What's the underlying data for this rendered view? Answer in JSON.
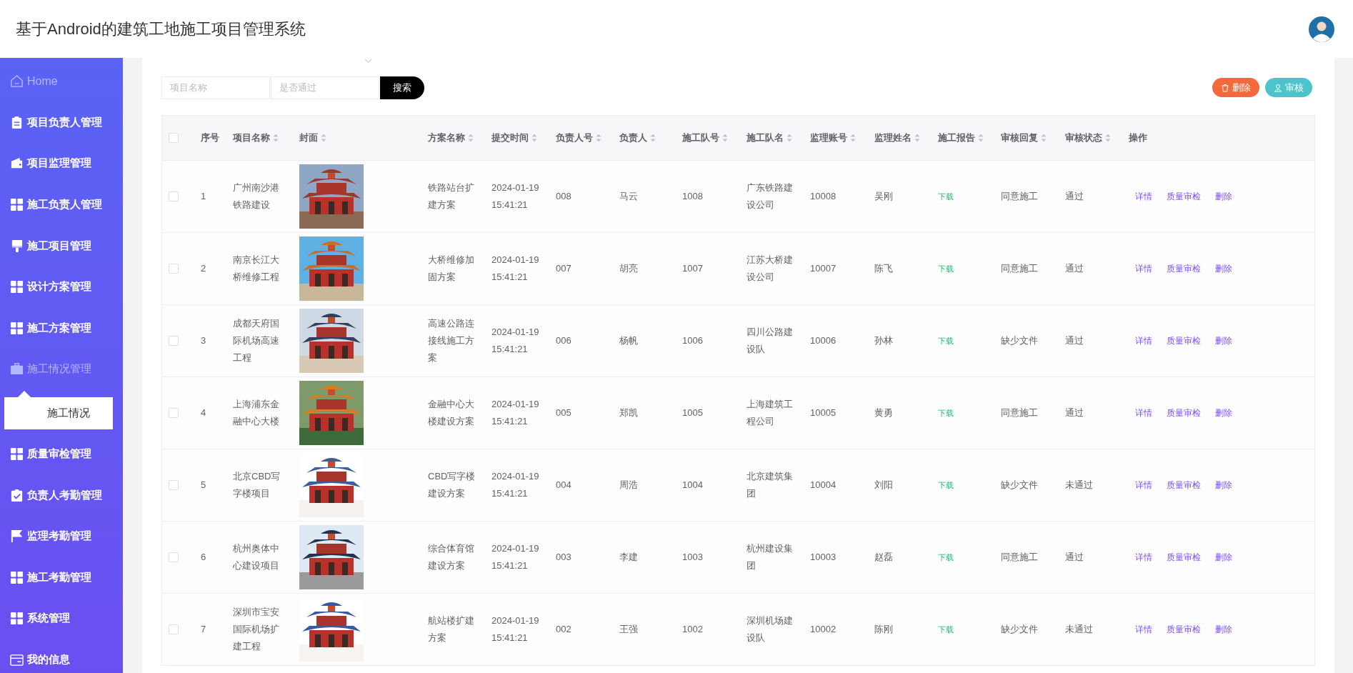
{
  "header": {
    "title": "基于Android的建筑工地施工项目管理系统"
  },
  "sidebar": {
    "items": [
      {
        "label": "Home",
        "kind": "home",
        "muted": true
      },
      {
        "label": "项目负责人管理",
        "kind": "clipboard",
        "muted": false
      },
      {
        "label": "项目监理管理",
        "kind": "wallet",
        "muted": false
      },
      {
        "label": "施工负责人管理",
        "kind": "grid",
        "muted": false
      },
      {
        "label": "施工项目管理",
        "kind": "brush",
        "muted": false
      },
      {
        "label": "设计方案管理",
        "kind": "grid",
        "muted": false
      },
      {
        "label": "施工方案管理",
        "kind": "grid",
        "muted": false
      },
      {
        "label": "施工情况管理",
        "kind": "briefcase",
        "expanded": true,
        "children": [
          {
            "label": "施工情况",
            "selected": true
          }
        ]
      },
      {
        "label": "质量审检管理",
        "kind": "grid",
        "muted": false
      },
      {
        "label": "负责人考勤管理",
        "kind": "check",
        "muted": false
      },
      {
        "label": "监理考勤管理",
        "kind": "flag",
        "muted": false
      },
      {
        "label": "施工考勤管理",
        "kind": "grid",
        "muted": false
      },
      {
        "label": "系统管理",
        "kind": "grid",
        "muted": false
      },
      {
        "label": "我的信息",
        "kind": "card",
        "muted": false
      }
    ]
  },
  "search": {
    "fields": [
      {
        "placeholder": "项目名称"
      },
      {
        "placeholder": "是否通过"
      }
    ],
    "button": "搜索"
  },
  "actions": [
    {
      "label": "删除",
      "kind": "delete"
    },
    {
      "label": "审核",
      "kind": "review"
    }
  ],
  "table": {
    "select_all": {
      "checked": false
    },
    "columns": [
      {
        "label": "序号",
        "sortable": false
      },
      {
        "label": "项目名称",
        "sortable": true
      },
      {
        "label": "封面",
        "sortable": true
      },
      {
        "label": "方案名称",
        "sortable": true
      },
      {
        "label": "提交时间",
        "sortable": true
      },
      {
        "label": "负责人号",
        "sortable": true
      },
      {
        "label": "负责人",
        "sortable": true
      },
      {
        "label": "施工队号",
        "sortable": true
      },
      {
        "label": "施工队名",
        "sortable": true
      },
      {
        "label": "监理账号",
        "sortable": true
      },
      {
        "label": "监理姓名",
        "sortable": true
      },
      {
        "label": "施工报告",
        "sortable": true
      },
      {
        "label": "审核回复",
        "sortable": true
      },
      {
        "label": "审核状态",
        "sortable": true
      },
      {
        "label": "操作",
        "sortable": false
      }
    ],
    "rows": [
      {
        "selected": false,
        "index": "1",
        "project": "广州南沙港铁路建设",
        "plan": "铁路站台扩建方案",
        "submitted": "2024-01-19 15:41:21",
        "leader_no": "008",
        "leader": "马云",
        "team_no": "1008",
        "team": "广东铁路建设公司",
        "supervisor_no": "10008",
        "supervisor": "吴刚",
        "report": "下载",
        "reply": "同意施工",
        "status": "通过",
        "ops": [
          "详情",
          "质量审检",
          "删除"
        ]
      },
      {
        "selected": false,
        "index": "2",
        "project": "南京长江大桥维修工程",
        "plan": "大桥维修加固方案",
        "submitted": "2024-01-19 15:41:21",
        "leader_no": "007",
        "leader": "胡亮",
        "team_no": "1007",
        "team": "江苏大桥建设公司",
        "supervisor_no": "10007",
        "supervisor": "陈飞",
        "report": "下载",
        "reply": "同意施工",
        "status": "通过",
        "ops": [
          "详情",
          "质量审检",
          "删除"
        ]
      },
      {
        "selected": false,
        "index": "3",
        "project": "成都天府国际机场高速工程",
        "plan": "高速公路连接线施工方案",
        "submitted": "2024-01-19 15:41:21",
        "leader_no": "006",
        "leader": "杨帆",
        "team_no": "1006",
        "team": "四川公路建设队",
        "supervisor_no": "10006",
        "supervisor": "孙林",
        "report": "下载",
        "reply": "缺少文件",
        "status": "通过",
        "ops": [
          "详情",
          "质量审检",
          "删除"
        ]
      },
      {
        "selected": false,
        "index": "4",
        "project": "上海浦东金融中心大楼",
        "plan": "金融中心大楼建设方案",
        "submitted": "2024-01-19 15:41:21",
        "leader_no": "005",
        "leader": "郑凯",
        "team_no": "1005",
        "team": "上海建筑工程公司",
        "supervisor_no": "10005",
        "supervisor": "黄勇",
        "report": "下载",
        "reply": "同意施工",
        "status": "通过",
        "ops": [
          "详情",
          "质量审检",
          "删除"
        ]
      },
      {
        "selected": false,
        "index": "5",
        "project": "北京CBD写字楼项目",
        "plan": "CBD写字楼建设方案",
        "submitted": "2024-01-19 15:41:21",
        "leader_no": "004",
        "leader": "周浩",
        "team_no": "1004",
        "team": "北京建筑集团",
        "supervisor_no": "10004",
        "supervisor": "刘阳",
        "report": "下载",
        "reply": "缺少文件",
        "status": "未通过",
        "ops": [
          "详情",
          "质量审检",
          "删除"
        ]
      },
      {
        "selected": false,
        "index": "6",
        "project": "杭州奥体中心建设项目",
        "plan": "综合体育馆建设方案",
        "submitted": "2024-01-19 15:41:21",
        "leader_no": "003",
        "leader": "李建",
        "team_no": "1003",
        "team": "杭州建设集团",
        "supervisor_no": "10003",
        "supervisor": "赵磊",
        "report": "下载",
        "reply": "同意施工",
        "status": "通过",
        "ops": [
          "详情",
          "质量审检",
          "删除"
        ]
      },
      {
        "selected": false,
        "index": "7",
        "project": "深圳市宝安国际机场扩建工程",
        "plan": "航站楼扩建方案",
        "submitted": "2024-01-19 15:41:21",
        "leader_no": "002",
        "leader": "王强",
        "team_no": "1002",
        "team": "深圳机场建设队",
        "supervisor_no": "10002",
        "supervisor": "陈刚",
        "report": "下载",
        "reply": "缺少文件",
        "status": "未通过",
        "ops": [
          "详情",
          "质量审检",
          "删除"
        ]
      }
    ]
  }
}
